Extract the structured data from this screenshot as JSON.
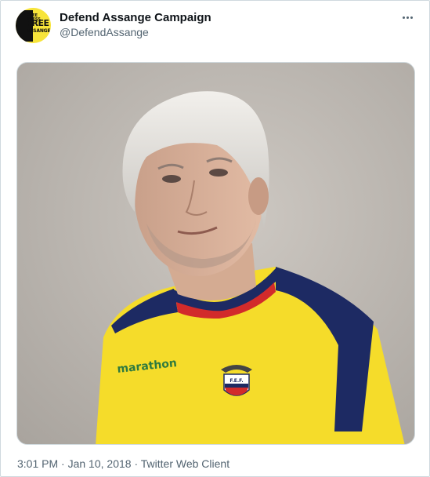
{
  "tweet": {
    "display_name": "Defend Assange Campaign",
    "handle": "@DefendAssange",
    "avatar": {
      "line1": "FREE PRESS",
      "line2": "FREE",
      "line3": "ASSANGE",
      "background": "#f7e43a"
    },
    "more_icon": "more-horizontal-icon",
    "media": {
      "jersey_brand": "marathon",
      "crest_letters": "F.E.F."
    },
    "time": "3:01 PM",
    "separator1": " · ",
    "date": "Jan 10, 2018",
    "separator2": " · ",
    "client": "Twitter Web Client"
  },
  "colors": {
    "text_primary": "#0f1419",
    "text_secondary": "#536471",
    "border": "#cfd9de",
    "jersey_yellow": "#f5dc2a",
    "jersey_navy": "#1d2a63"
  }
}
